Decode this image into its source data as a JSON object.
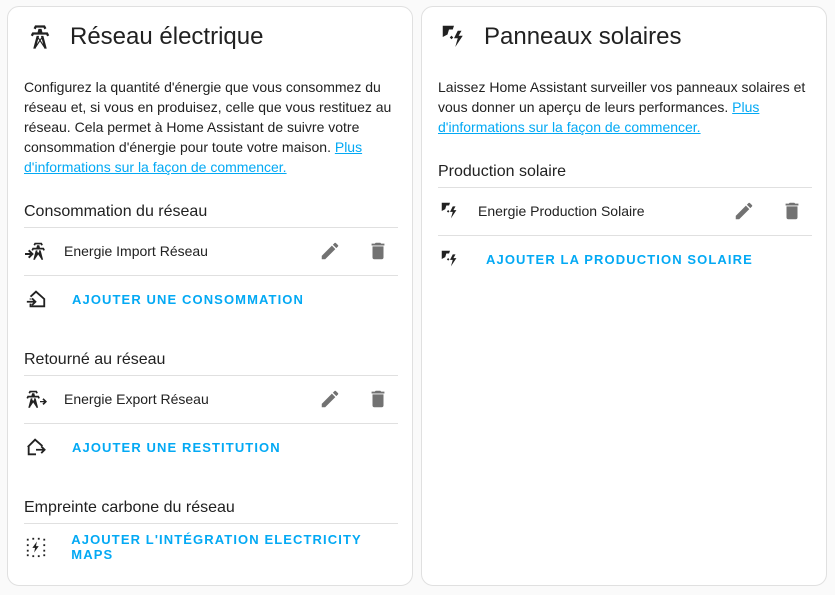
{
  "colors": {
    "accent": "#03a9f4",
    "icon": "#212121",
    "action_icon": "#727272",
    "divider": "#e0e0e0"
  },
  "grid_card": {
    "title": "Réseau électrique",
    "icon": "transmission-tower-icon",
    "description": "Configurez la quantité d'énergie que vous consommez du réseau et, si vous en produisez, celle que vous restituez au réseau. Cela permet à Home Assistant de suivre votre consommation d'énergie pour toute votre maison.",
    "more_info_link": "Plus d'informations sur la façon de commencer.",
    "consumption": {
      "title": "Consommation du réseau",
      "item_label": "Energie Import Réseau",
      "add_label": "AJOUTER UNE CONSOMMATION"
    },
    "return": {
      "title": "Retourné au réseau",
      "item_label": "Energie Export Réseau",
      "add_label": "AJOUTER UNE RESTITUTION"
    },
    "co2": {
      "title": "Empreinte carbone du réseau",
      "add_label": "AJOUTER L'INTÉGRATION ELECTRICITY MAPS"
    }
  },
  "solar_card": {
    "title": "Panneaux solaires",
    "icon": "solar-power-icon",
    "description": "Laissez Home Assistant surveiller vos panneaux solaires et vous donner un aperçu de leurs performances.",
    "more_info_link": "Plus d'informations sur la façon de commencer.",
    "production": {
      "title": "Production solaire",
      "item_label": "Energie Production Solaire",
      "add_label": "AJOUTER LA PRODUCTION SOLAIRE"
    }
  }
}
